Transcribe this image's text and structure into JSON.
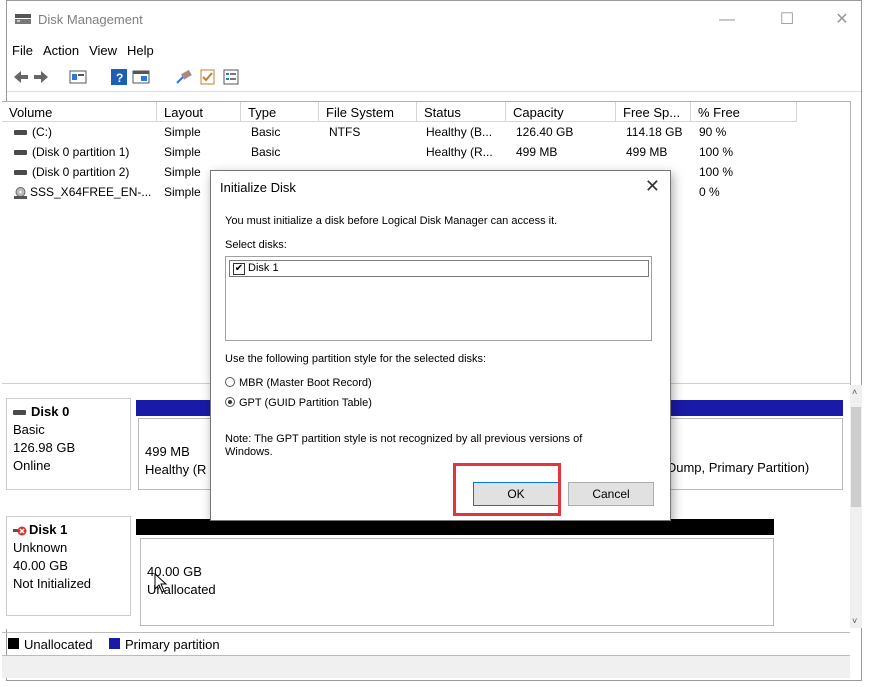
{
  "window": {
    "title": "Disk Management",
    "controls": [
      "—",
      "☐",
      "✕"
    ]
  },
  "menu": [
    "File",
    "Action",
    "View",
    "Help"
  ],
  "volumes": {
    "columns": [
      "Volume",
      "Layout",
      "Type",
      "File System",
      "Status",
      "Capacity",
      "Free Sp...",
      "% Free"
    ],
    "rows": [
      {
        "volume": "(C:)",
        "layout": "Simple",
        "type": "Basic",
        "fs": "NTFS",
        "status": "Healthy (B...",
        "capacity": "126.40 GB",
        "free": "114.18 GB",
        "pct": "90 %"
      },
      {
        "volume": "(Disk 0 partition 1)",
        "layout": "Simple",
        "type": "Basic",
        "fs": "",
        "status": "Healthy (R...",
        "capacity": "499 MB",
        "free": "499 MB",
        "pct": "100 %"
      },
      {
        "volume": "(Disk 0 partition 2)",
        "layout": "Simple",
        "type": "",
        "fs": "",
        "status": "",
        "capacity": "",
        "free": "",
        "pct": "100 %"
      },
      {
        "volume": "SSS_X64FREE_EN-...",
        "layout": "Simple",
        "type": "",
        "fs": "",
        "status": "",
        "capacity": "",
        "free": "",
        "pct": "0 %"
      }
    ]
  },
  "disks": [
    {
      "name": "Disk 0",
      "type": "Basic",
      "size": "126.98 GB",
      "state": "Online",
      "part_size": "499 MB",
      "part_status": "Healthy (R",
      "right_text": "n Dump, Primary Partition)"
    },
    {
      "name": "Disk 1",
      "type": "Unknown",
      "size": "40.00 GB",
      "state": "Not Initialized",
      "part_size": "40.00 GB",
      "part_status": "Unallocated"
    }
  ],
  "legend": {
    "unallocated": "Unallocated",
    "primary": "Primary partition"
  },
  "dialog": {
    "title": "Initialize Disk",
    "intro": "You must initialize a disk before Logical Disk Manager can access it.",
    "select_label": "Select disks:",
    "disk_item": "Disk 1",
    "style_label": "Use the following partition style for the selected disks:",
    "mbr": "MBR (Master Boot Record)",
    "gpt": "GPT (GUID Partition Table)",
    "note": "Note: The GPT partition style is not recognized by all previous versions of Windows.",
    "ok": "OK",
    "cancel": "Cancel",
    "close": "✕"
  },
  "colors": {
    "primary_partition": "#1a1aa8",
    "unallocated": "#000000",
    "highlight": "#e0363d"
  }
}
